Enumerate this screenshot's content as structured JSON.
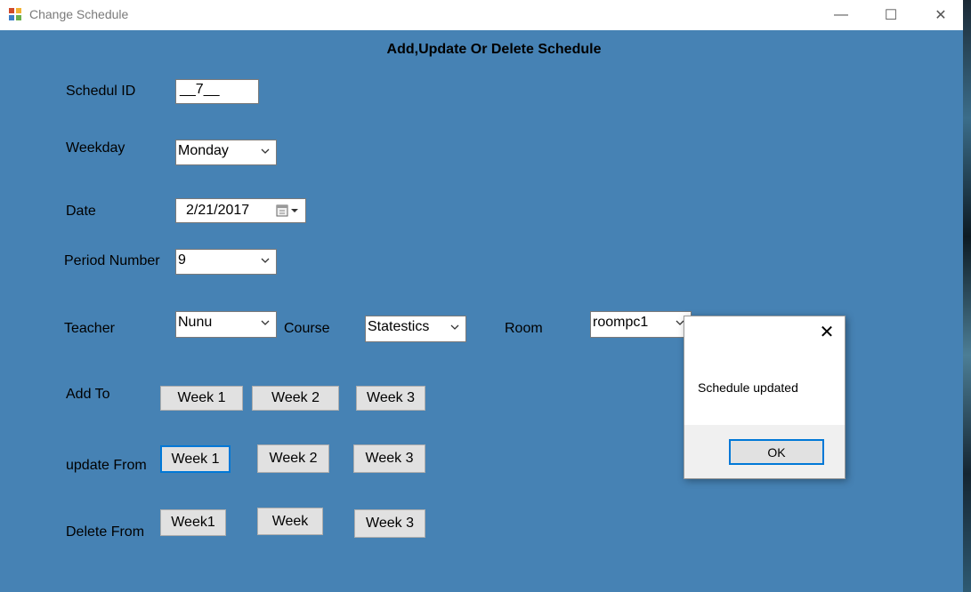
{
  "window": {
    "title": "Change Schedule",
    "minimize_glyph": "—",
    "maximize_glyph": "☐",
    "close_glyph": "✕"
  },
  "form": {
    "heading": "Add,Update Or Delete Schedule",
    "schedule_id": {
      "label": "Schedul ID",
      "value": "__7__"
    },
    "weekday": {
      "label": "Weekday",
      "value": "Monday"
    },
    "date": {
      "label": "Date",
      "value": "2/21/2017"
    },
    "period": {
      "label": "Period Number",
      "value": "9"
    },
    "teacher": {
      "label": "Teacher",
      "value": "Nunu"
    },
    "course": {
      "label": "Course",
      "value": "Statestics"
    },
    "room": {
      "label": "Room",
      "value": "roompc1"
    },
    "add_to": {
      "label": "Add To",
      "buttons": [
        "Week 1",
        "Week 2",
        "Week 3"
      ]
    },
    "update_from": {
      "label": "update From",
      "buttons": [
        "Week 1",
        "Week 2",
        "Week 3"
      ]
    },
    "delete_from": {
      "label": "Delete From",
      "buttons": [
        "Week1",
        "Week",
        "Week 3"
      ]
    }
  },
  "dialog": {
    "message": "Schedule updated",
    "ok_label": "OK",
    "close_glyph": "✕"
  },
  "icons": {
    "app": "app-icon",
    "calendar": "calendar-icon",
    "dropdown": "chevron-down-icon"
  },
  "colors": {
    "form_background": "#4682b4",
    "focus_border": "#0078d7",
    "button_face": "#e1e1e1"
  }
}
